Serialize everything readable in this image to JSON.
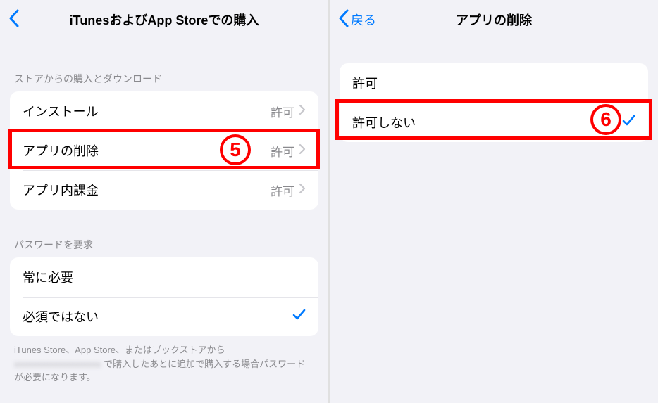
{
  "left": {
    "header": {
      "title": "iTunesおよびApp Storeでの購入"
    },
    "section1": {
      "header": "ストアからの購入とダウンロード",
      "rows": [
        {
          "label": "インストール",
          "value": "許可"
        },
        {
          "label": "アプリの削除",
          "value": "許可"
        },
        {
          "label": "アプリ内課金",
          "value": "許可"
        }
      ]
    },
    "section2": {
      "header": "パスワードを要求",
      "rows": [
        {
          "label": "常に必要"
        },
        {
          "label": "必須ではない"
        }
      ]
    },
    "footer": {
      "part1": "iTunes Store、App Store、またはブックストアから",
      "blurred": "xxxxxxxxxxxxxxxxxxx",
      "part2": "で購入したあとに追加で購入する場合パスワードが必要になります。"
    },
    "badge": "5"
  },
  "right": {
    "header": {
      "back": "戻る",
      "title": "アプリの削除"
    },
    "rows": [
      {
        "label": "許可"
      },
      {
        "label": "許可しない"
      }
    ],
    "badge": "6"
  }
}
